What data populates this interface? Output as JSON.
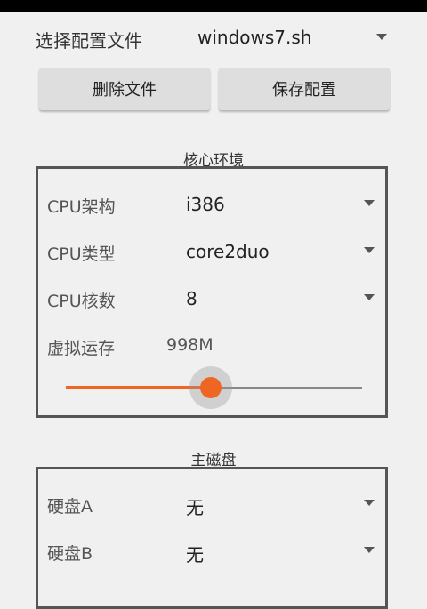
{
  "config_file": {
    "label": "选择配置文件",
    "selected": "windows7.sh"
  },
  "buttons": {
    "delete": "删除文件",
    "save": "保存配置"
  },
  "core_env": {
    "title": "核心环境",
    "cpu_arch": {
      "label": "CPU架构",
      "value": "i386"
    },
    "cpu_type": {
      "label": "CPU类型",
      "value": "core2duo"
    },
    "cpu_cores": {
      "label": "CPU核数",
      "value": "8"
    },
    "ram": {
      "label": "虚拟运存",
      "value": "998M",
      "slider_fraction": 0.49
    }
  },
  "main_disk": {
    "title": "主磁盘",
    "disk_a": {
      "label": "硬盘A",
      "value": "无"
    },
    "disk_b": {
      "label": "硬盘B",
      "value": "无"
    }
  },
  "colors": {
    "accent": "#ef6524",
    "border": "#555555",
    "background": "#f0f0f0"
  }
}
